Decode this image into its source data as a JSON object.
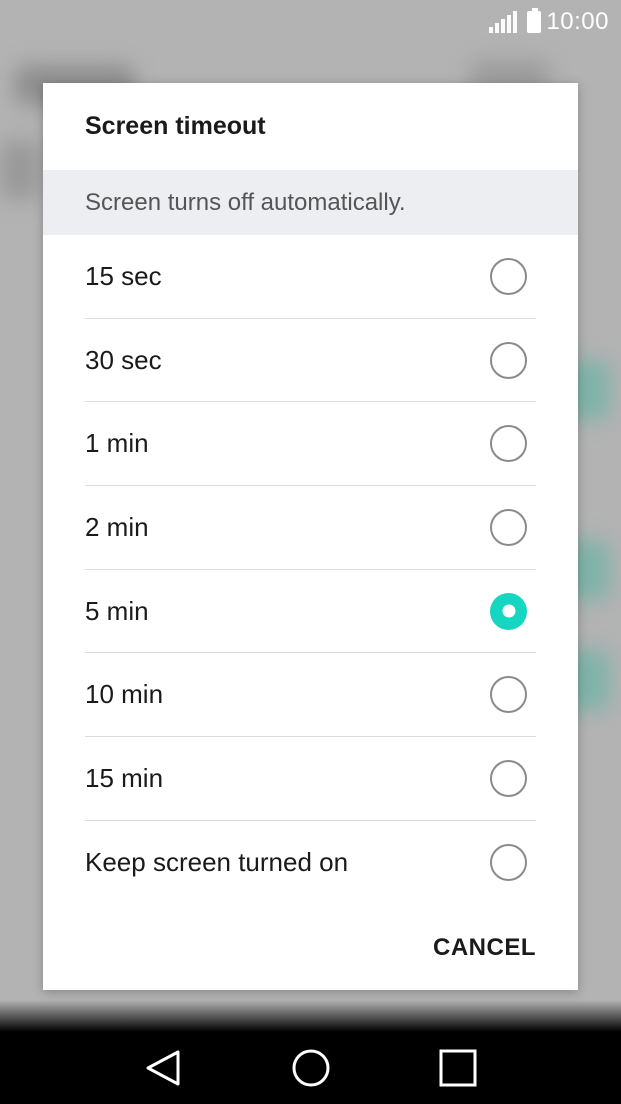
{
  "status_bar": {
    "time": "10:00"
  },
  "dialog": {
    "title": "Screen timeout",
    "subtitle": "Screen turns off automatically.",
    "options": [
      {
        "label": "15 sec",
        "selected": false
      },
      {
        "label": "30 sec",
        "selected": false
      },
      {
        "label": "1 min",
        "selected": false
      },
      {
        "label": "2 min",
        "selected": false
      },
      {
        "label": "5 min",
        "selected": true
      },
      {
        "label": "10 min",
        "selected": false
      },
      {
        "label": "15 min",
        "selected": false
      },
      {
        "label": "Keep screen turned on",
        "selected": false
      }
    ],
    "cancel_label": "CANCEL"
  },
  "colors": {
    "accent": "#15d6c1",
    "scrim": "#b3b3b3",
    "subtitle_bg": "#eceef1"
  },
  "nav_bar": {
    "icons": [
      "back-icon",
      "home-icon",
      "recents-icon"
    ]
  }
}
